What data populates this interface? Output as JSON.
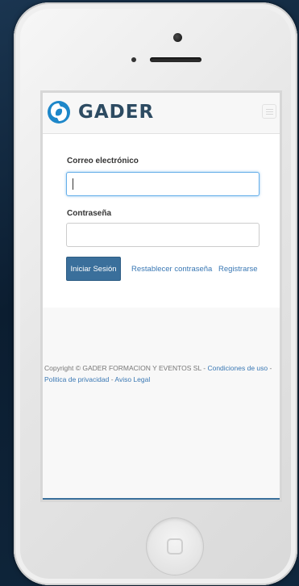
{
  "brand": {
    "name": "GADER",
    "logo_color": "#1e87c9",
    "text_color": "#2d4b62"
  },
  "navbar": {
    "menu_icon": "hamburger-menu-icon"
  },
  "form": {
    "email_label": "Correo electrónico",
    "email_value": "",
    "password_label": "Contraseña",
    "password_value": "",
    "login_button": "Iniciar Sesión",
    "reset_link": "Restablecer contraseña",
    "register_link": "Registrarse"
  },
  "footer": {
    "copyright": "Copyright © GADER FORMACION Y EVENTOS SL - ",
    "terms_link": "Condiciones de uso",
    "sep1": " - ",
    "privacy_link": "Politica de privacidad",
    "sep2": " - ",
    "legal_link": "Aviso Legal"
  },
  "colors": {
    "primary_button": "#3a6f9b",
    "link": "#3a78b4",
    "focus_border": "#66afe9"
  }
}
